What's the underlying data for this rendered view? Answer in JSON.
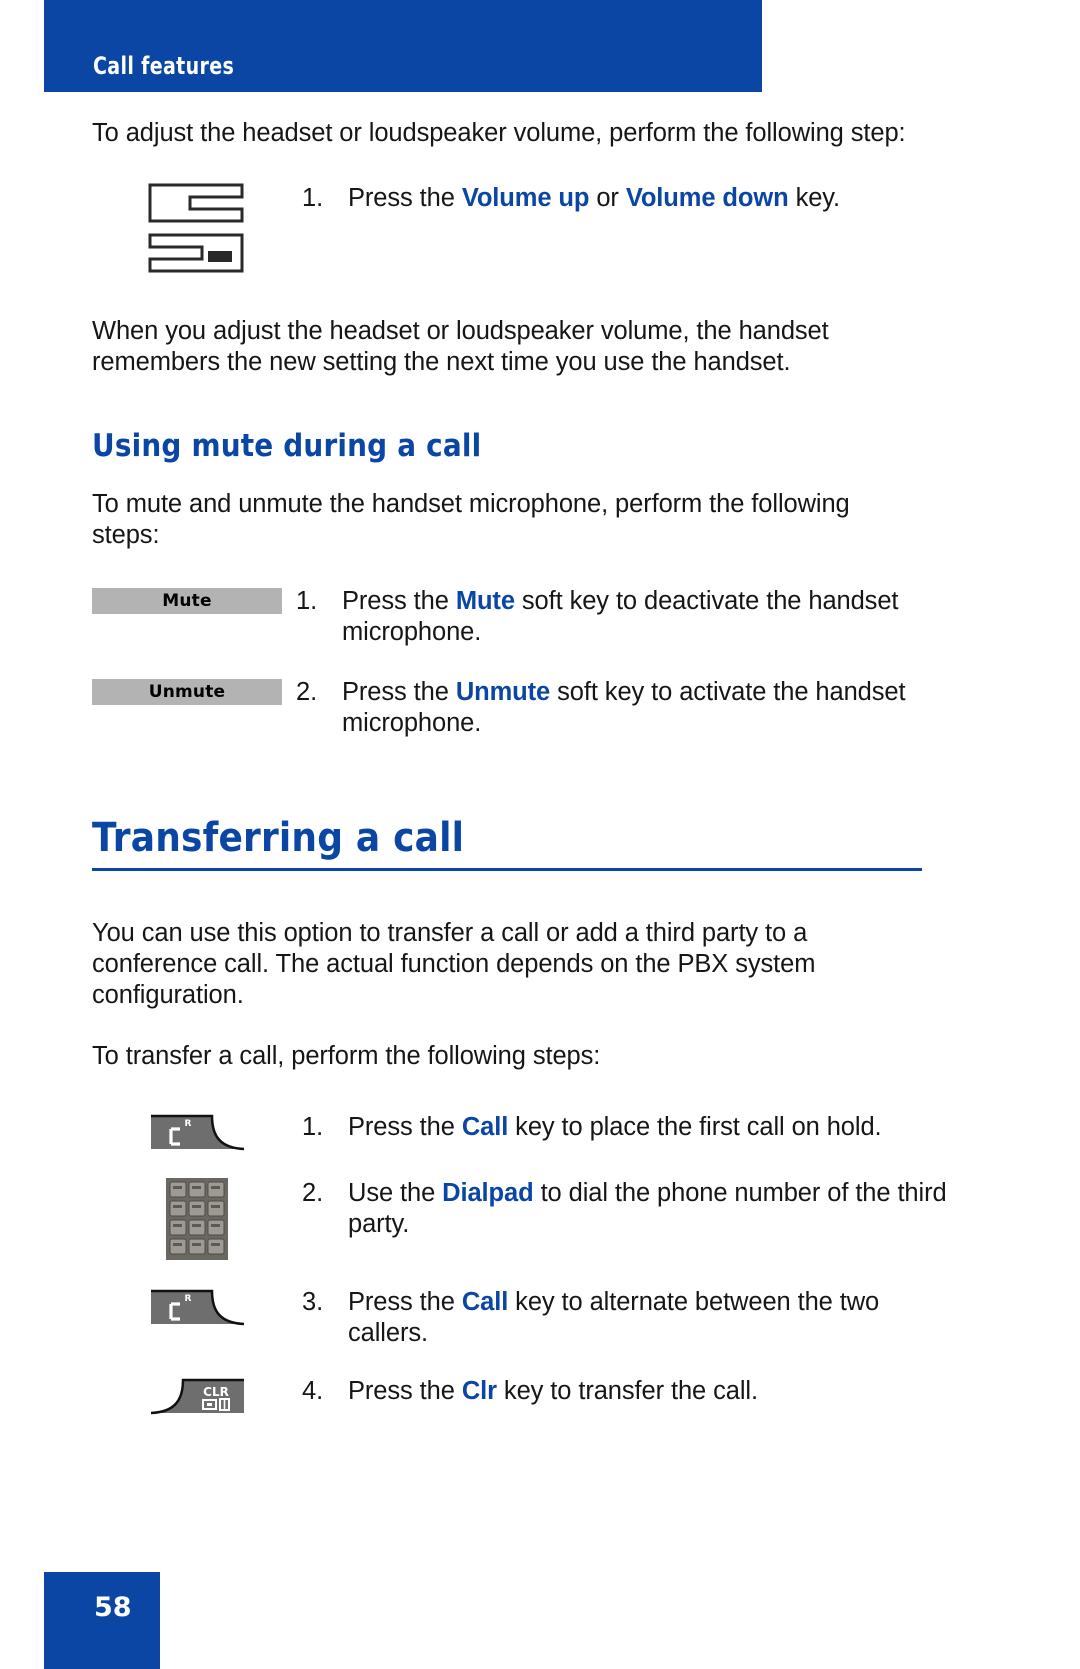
{
  "header": {
    "chapter_label": "Call features",
    "band_color": "#0B46A5"
  },
  "volume_section": {
    "intro": "To adjust the headset or loudspeaker volume, perform the following step:",
    "step": {
      "number": "1.",
      "before": "Press the ",
      "keyword1": "Volume up",
      "middle": " or ",
      "keyword2": "Volume down",
      "after": " key."
    },
    "note": "When you adjust the headset or loudspeaker volume, the handset remembers the new setting the next time you use the handset.",
    "icon_name": "volume-rocker-key"
  },
  "mute_section": {
    "heading": "Using mute during a call",
    "intro": "To mute and unmute the handset microphone, perform the following steps:",
    "steps": [
      {
        "number": "1.",
        "softkey_label": "Mute",
        "before": "Press the ",
        "keyword": "Mute",
        "after": " soft key to deactivate the handset microphone."
      },
      {
        "number": "2.",
        "softkey_label": "Unmute",
        "before": "Press the ",
        "keyword": "Unmute",
        "after": " soft key to activate the handset microphone."
      }
    ]
  },
  "transfer_section": {
    "heading": "Transferring a call",
    "paragraph1": "You can use this option to transfer a call or add a third party to a conference call. The actual function depends on the PBX system configuration.",
    "paragraph2": "To transfer a call, perform the following steps:",
    "steps": [
      {
        "number": "1.",
        "icon": "call-key",
        "icon_glyph": "R",
        "before": "Press the ",
        "keyword": "Call",
        "after": " key to place the first call on hold."
      },
      {
        "number": "2.",
        "icon": "dialpad",
        "icon_glyph": "",
        "before": "Use the ",
        "keyword": "Dialpad",
        "after": " to dial the phone number of the third party."
      },
      {
        "number": "3.",
        "icon": "call-key",
        "icon_glyph": "R",
        "before": "Press the ",
        "keyword": "Call",
        "after": " key to alternate between the two callers."
      },
      {
        "number": "4.",
        "icon": "clr-key",
        "icon_glyph": "CLR",
        "before": "Press the ",
        "keyword": "Clr",
        "after": " key to transfer the call."
      }
    ]
  },
  "footer": {
    "page_number": "58"
  },
  "colors": {
    "brand_blue": "#0B46A5",
    "softkey_gray": "#B3B3B3",
    "key_gray": "#6E6E6E",
    "body_black": "#161616"
  }
}
